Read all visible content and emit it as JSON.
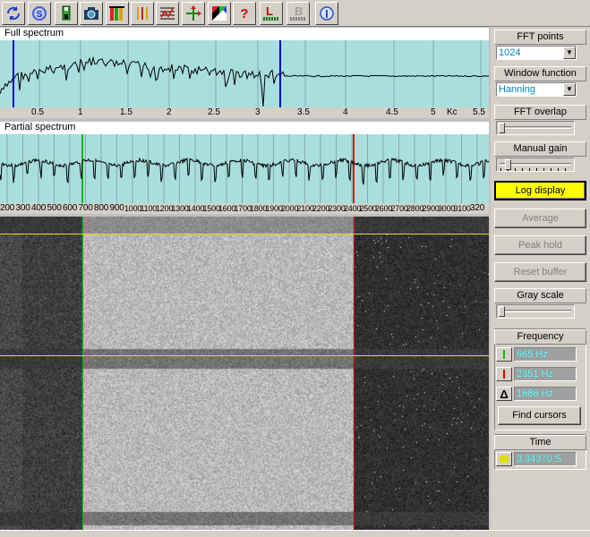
{
  "toolbar": {
    "buttons": [
      {
        "icon": "refresh-icon"
      },
      {
        "icon": "sync-icon"
      },
      {
        "icon": "save-icon"
      },
      {
        "icon": "camera-icon"
      },
      {
        "icon": "color-bars-icon"
      },
      {
        "icon": "vertical-bars-icon"
      },
      {
        "icon": "grid-chart-icon"
      },
      {
        "icon": "arrows-icon"
      },
      {
        "icon": "color-palette-icon"
      },
      {
        "icon": "help-icon"
      },
      {
        "icon": "cursor-l-icon"
      },
      {
        "icon": "cursor-b-icon"
      },
      {
        "icon": "info-icon"
      }
    ],
    "help_glyph": "?",
    "cursor_l": "L",
    "cursor_b": "B"
  },
  "full_spectrum": {
    "title": "Full spectrum",
    "ticks": [
      "0.5",
      "1",
      "1.5",
      "2",
      "2.5",
      "3",
      "3.5",
      "4",
      "4.5",
      "5",
      "5.5"
    ],
    "unit": "Kc"
  },
  "partial_spectrum": {
    "title": "Partial spectrum",
    "ticks": [
      "200",
      "300",
      "400",
      "500",
      "600",
      "700",
      "800",
      "900",
      "1000",
      "1100",
      "1200",
      "1300",
      "1400",
      "1500",
      "1600",
      "1700",
      "1800",
      "1900",
      "2000",
      "2100",
      "2200",
      "2300",
      "2400",
      "2500",
      "2600",
      "2700",
      "2800",
      "2900",
      "3000",
      "3100",
      "320"
    ]
  },
  "controls": {
    "fft_points": {
      "label": "FFT points",
      "value": "1024"
    },
    "window_function": {
      "label": "Window function",
      "value": "Hanning"
    },
    "fft_overlap": {
      "label": "FFT overlap",
      "level": 0.0
    },
    "manual_gain": {
      "label": "Manual gain",
      "level": 0.08
    },
    "log_display": "Log display",
    "average": "Average",
    "peak_hold": "Peak hold",
    "reset_buffer": "Reset buffer",
    "gray_scale": {
      "label": "Gray scale",
      "level": 0.0
    },
    "frequency": {
      "label": "Frequency",
      "cursor1": "665 Hz",
      "cursor2": "2351 Hz",
      "delta": "1686 Hz",
      "delta_glyph": "Δ"
    },
    "find_cursors": "Find cursors",
    "time": {
      "label": "Time",
      "value": "3.34370 S"
    }
  },
  "colors": {
    "plot_bg": "#a9dede",
    "cursor_green": "#00c000",
    "cursor_red": "#e00000",
    "cursor_blue": "#0000c0",
    "time_line": "#e0e000",
    "log_active": "#ffff00"
  }
}
